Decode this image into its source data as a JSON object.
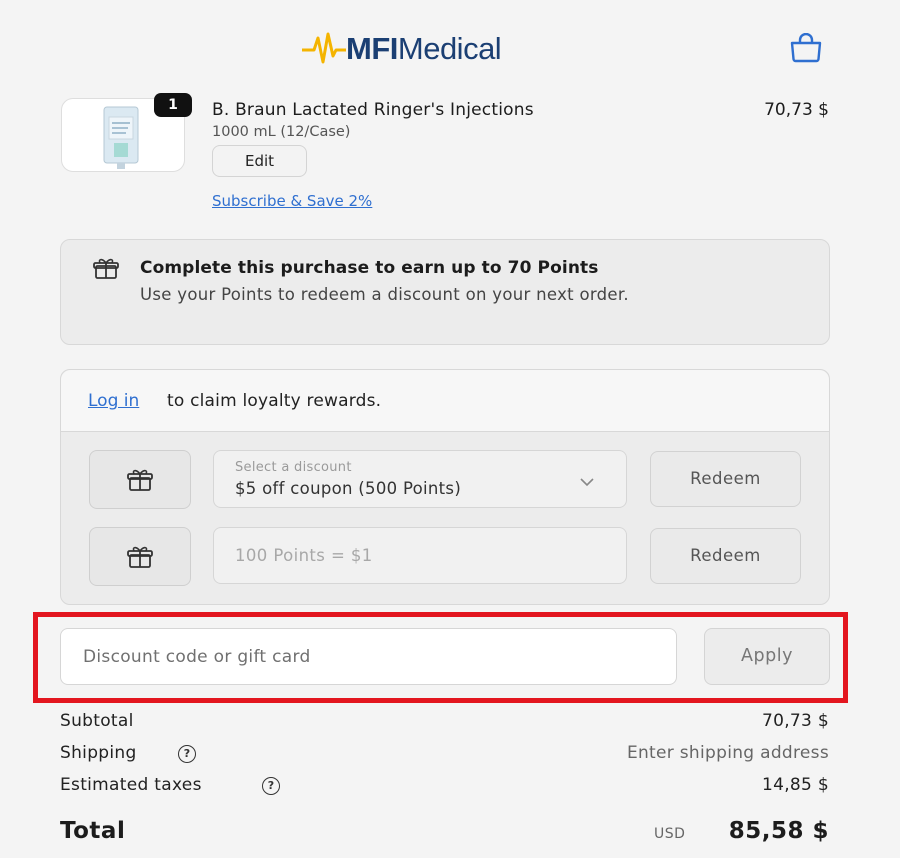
{
  "header": {
    "logo_bold": "MFI",
    "logo_light": "Medical",
    "brand_color": "#1b3f73",
    "accent_color": "#f4b400",
    "cart_icon": "shopping-bag-icon"
  },
  "product": {
    "quantity": "1",
    "name": "B. Braun Lactated Ringer's Injections",
    "variant": "1000 mL (12/Case)",
    "edit_label": "Edit",
    "price": "70,73 $",
    "subscribe_label": "Subscribe & Save 2%"
  },
  "points_banner": {
    "icon": "gift-icon",
    "title": "Complete this purchase to earn up to 70 Points",
    "description": "Use your Points to redeem a discount on your next order."
  },
  "loyalty": {
    "login_label": "Log in",
    "claim_text": "to claim loyalty rewards.",
    "discount_select": {
      "label": "Select a discount",
      "value": "$5 off coupon (500 Points)"
    },
    "points_placeholder": "100 Points = $1",
    "redeem_label": "Redeem"
  },
  "discount": {
    "placeholder": "Discount code or gift card",
    "apply_label": "Apply",
    "highlight_color": "#e3161f"
  },
  "summary": {
    "subtotal_label": "Subtotal",
    "subtotal_value": "70,73 $",
    "shipping_label": "Shipping",
    "shipping_value": "Enter shipping address",
    "taxes_label": "Estimated taxes",
    "taxes_value": "14,85 $",
    "help_glyph": "?",
    "total_label": "Total",
    "currency": "USD",
    "total_value": "85,58 $"
  }
}
